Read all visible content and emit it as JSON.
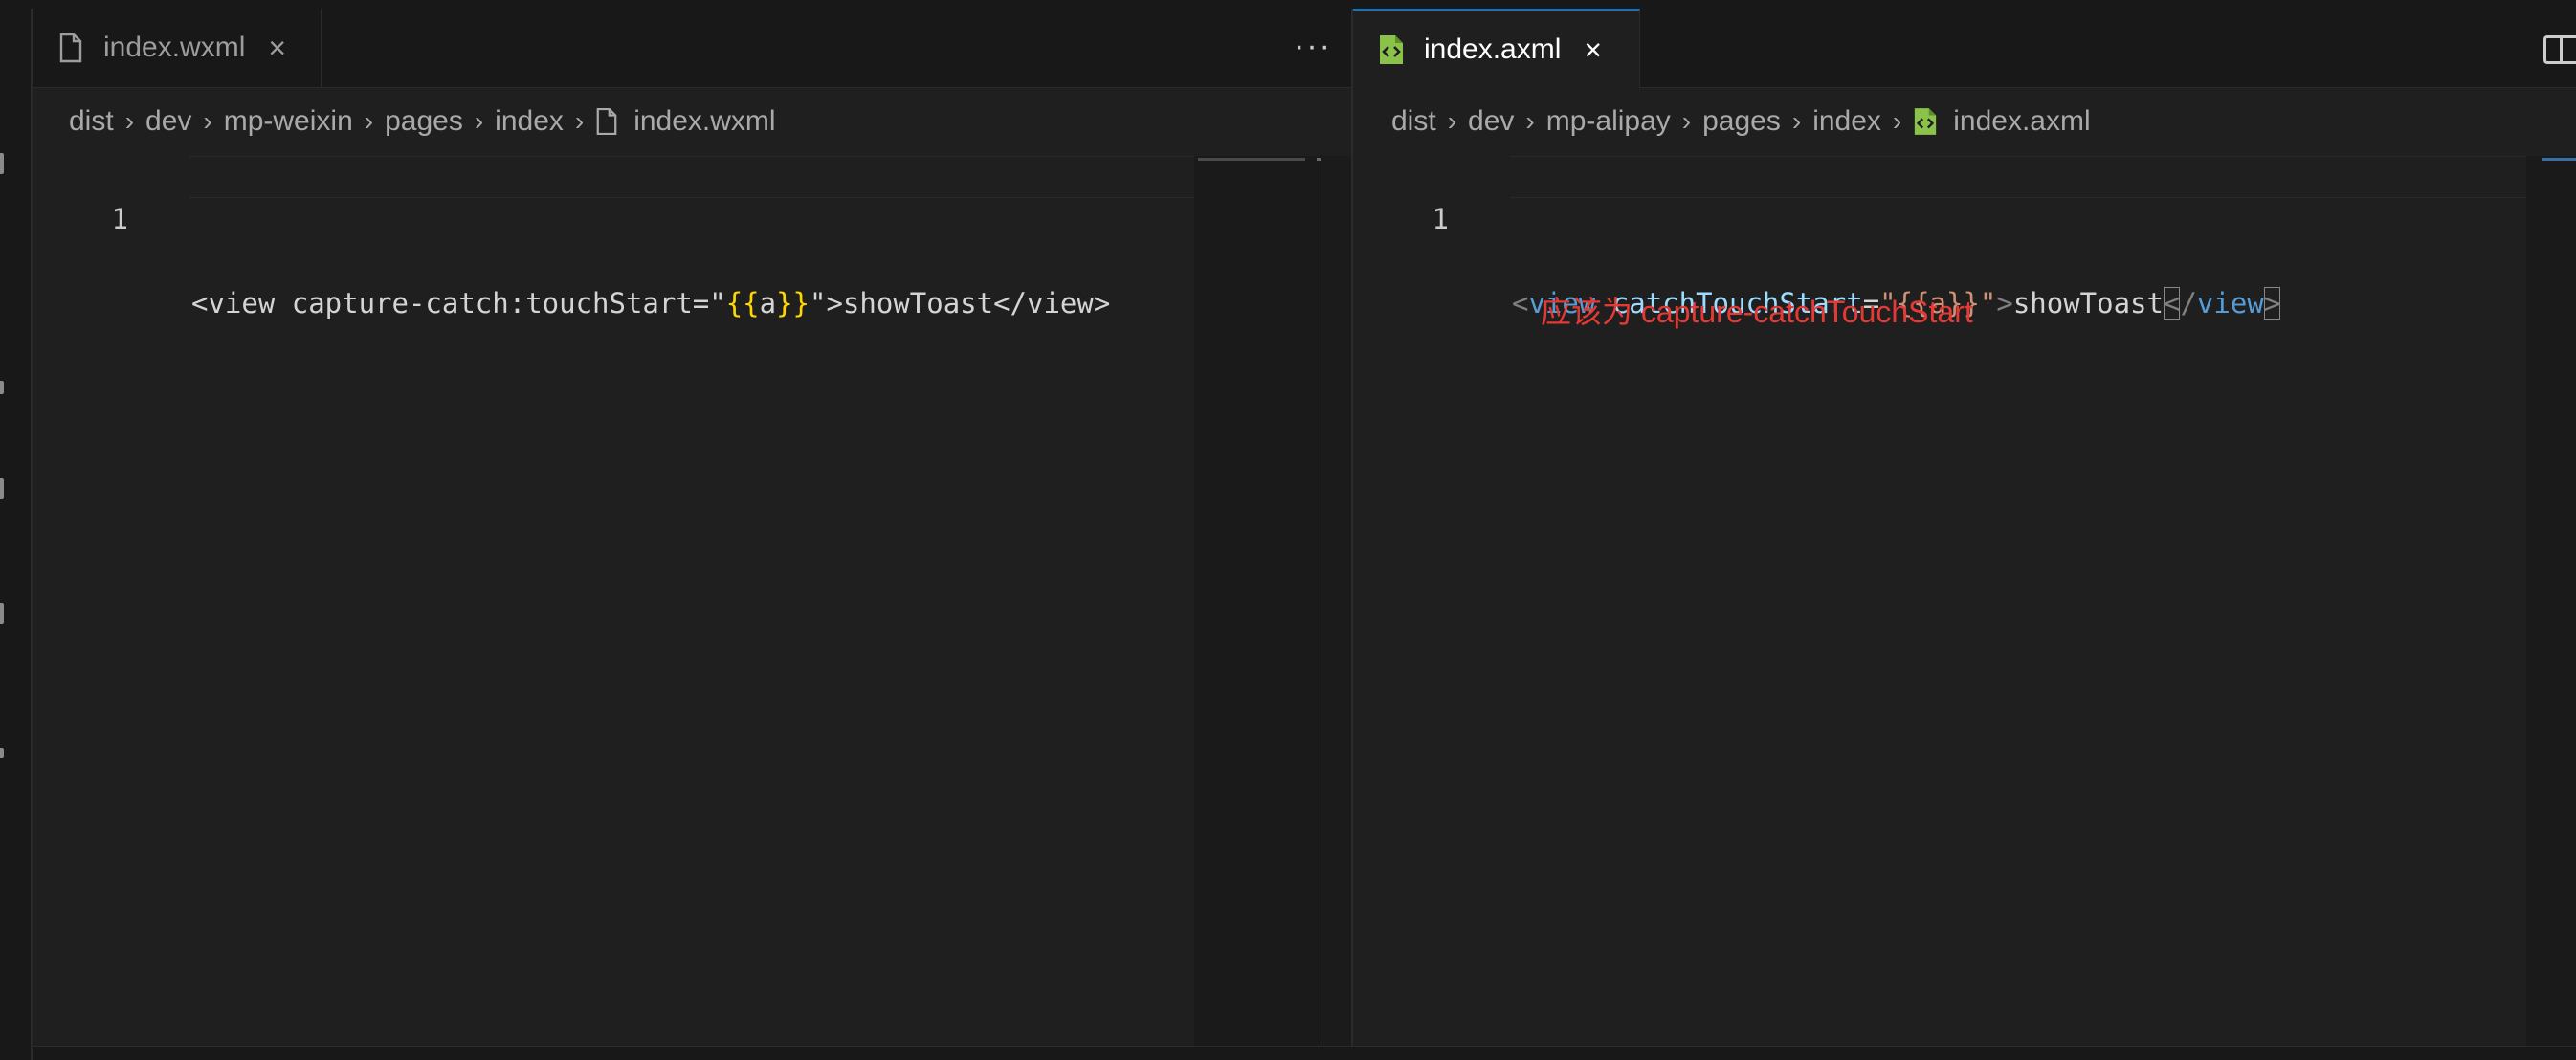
{
  "left_pane": {
    "tab": {
      "label": "index.wxml",
      "close": "×"
    },
    "more_actions": "···",
    "breadcrumb": [
      "dist",
      "dev",
      "mp-weixin",
      "pages",
      "index",
      "index.wxml"
    ],
    "line_number": "1",
    "code": {
      "t1": "<view capture-catch:touchStart=\"",
      "t2": "{{",
      "t3": "a",
      "t4": "}}",
      "t5": "\">showToast</view>"
    }
  },
  "right_pane": {
    "tab": {
      "label": "index.axml",
      "close": "×"
    },
    "breadcrumb": [
      "dist",
      "dev",
      "mp-alipay",
      "pages",
      "index",
      "index.axml"
    ],
    "line_number": "1",
    "code": {
      "t1": "<",
      "t2": "view",
      "t3": " ",
      "t4": "catchTouchStart",
      "t5": "=",
      "t6": "\"{{a}}\"",
      "t7": ">",
      "t8": "showToast",
      "t9": "<",
      "t10": "/",
      "t11": "view",
      "t12": ">"
    },
    "annotation": "应该为 capture-catchTouchStart"
  },
  "icons": {
    "file": "file-icon",
    "axml_file": "axml-file-icon",
    "close": "close-icon",
    "more": "more-actions-icon",
    "split": "split-editor-icon",
    "chevron": "chevron-right-icon"
  },
  "colors": {
    "background": "#1f1f1f",
    "tab_active_border": "#0078d4",
    "annotation": "#e53935",
    "axml_icon": "#8bc34a",
    "tag": "#569cd6",
    "attribute": "#9cdcfe",
    "string": "#ce9178",
    "brace": "#ffd700"
  }
}
